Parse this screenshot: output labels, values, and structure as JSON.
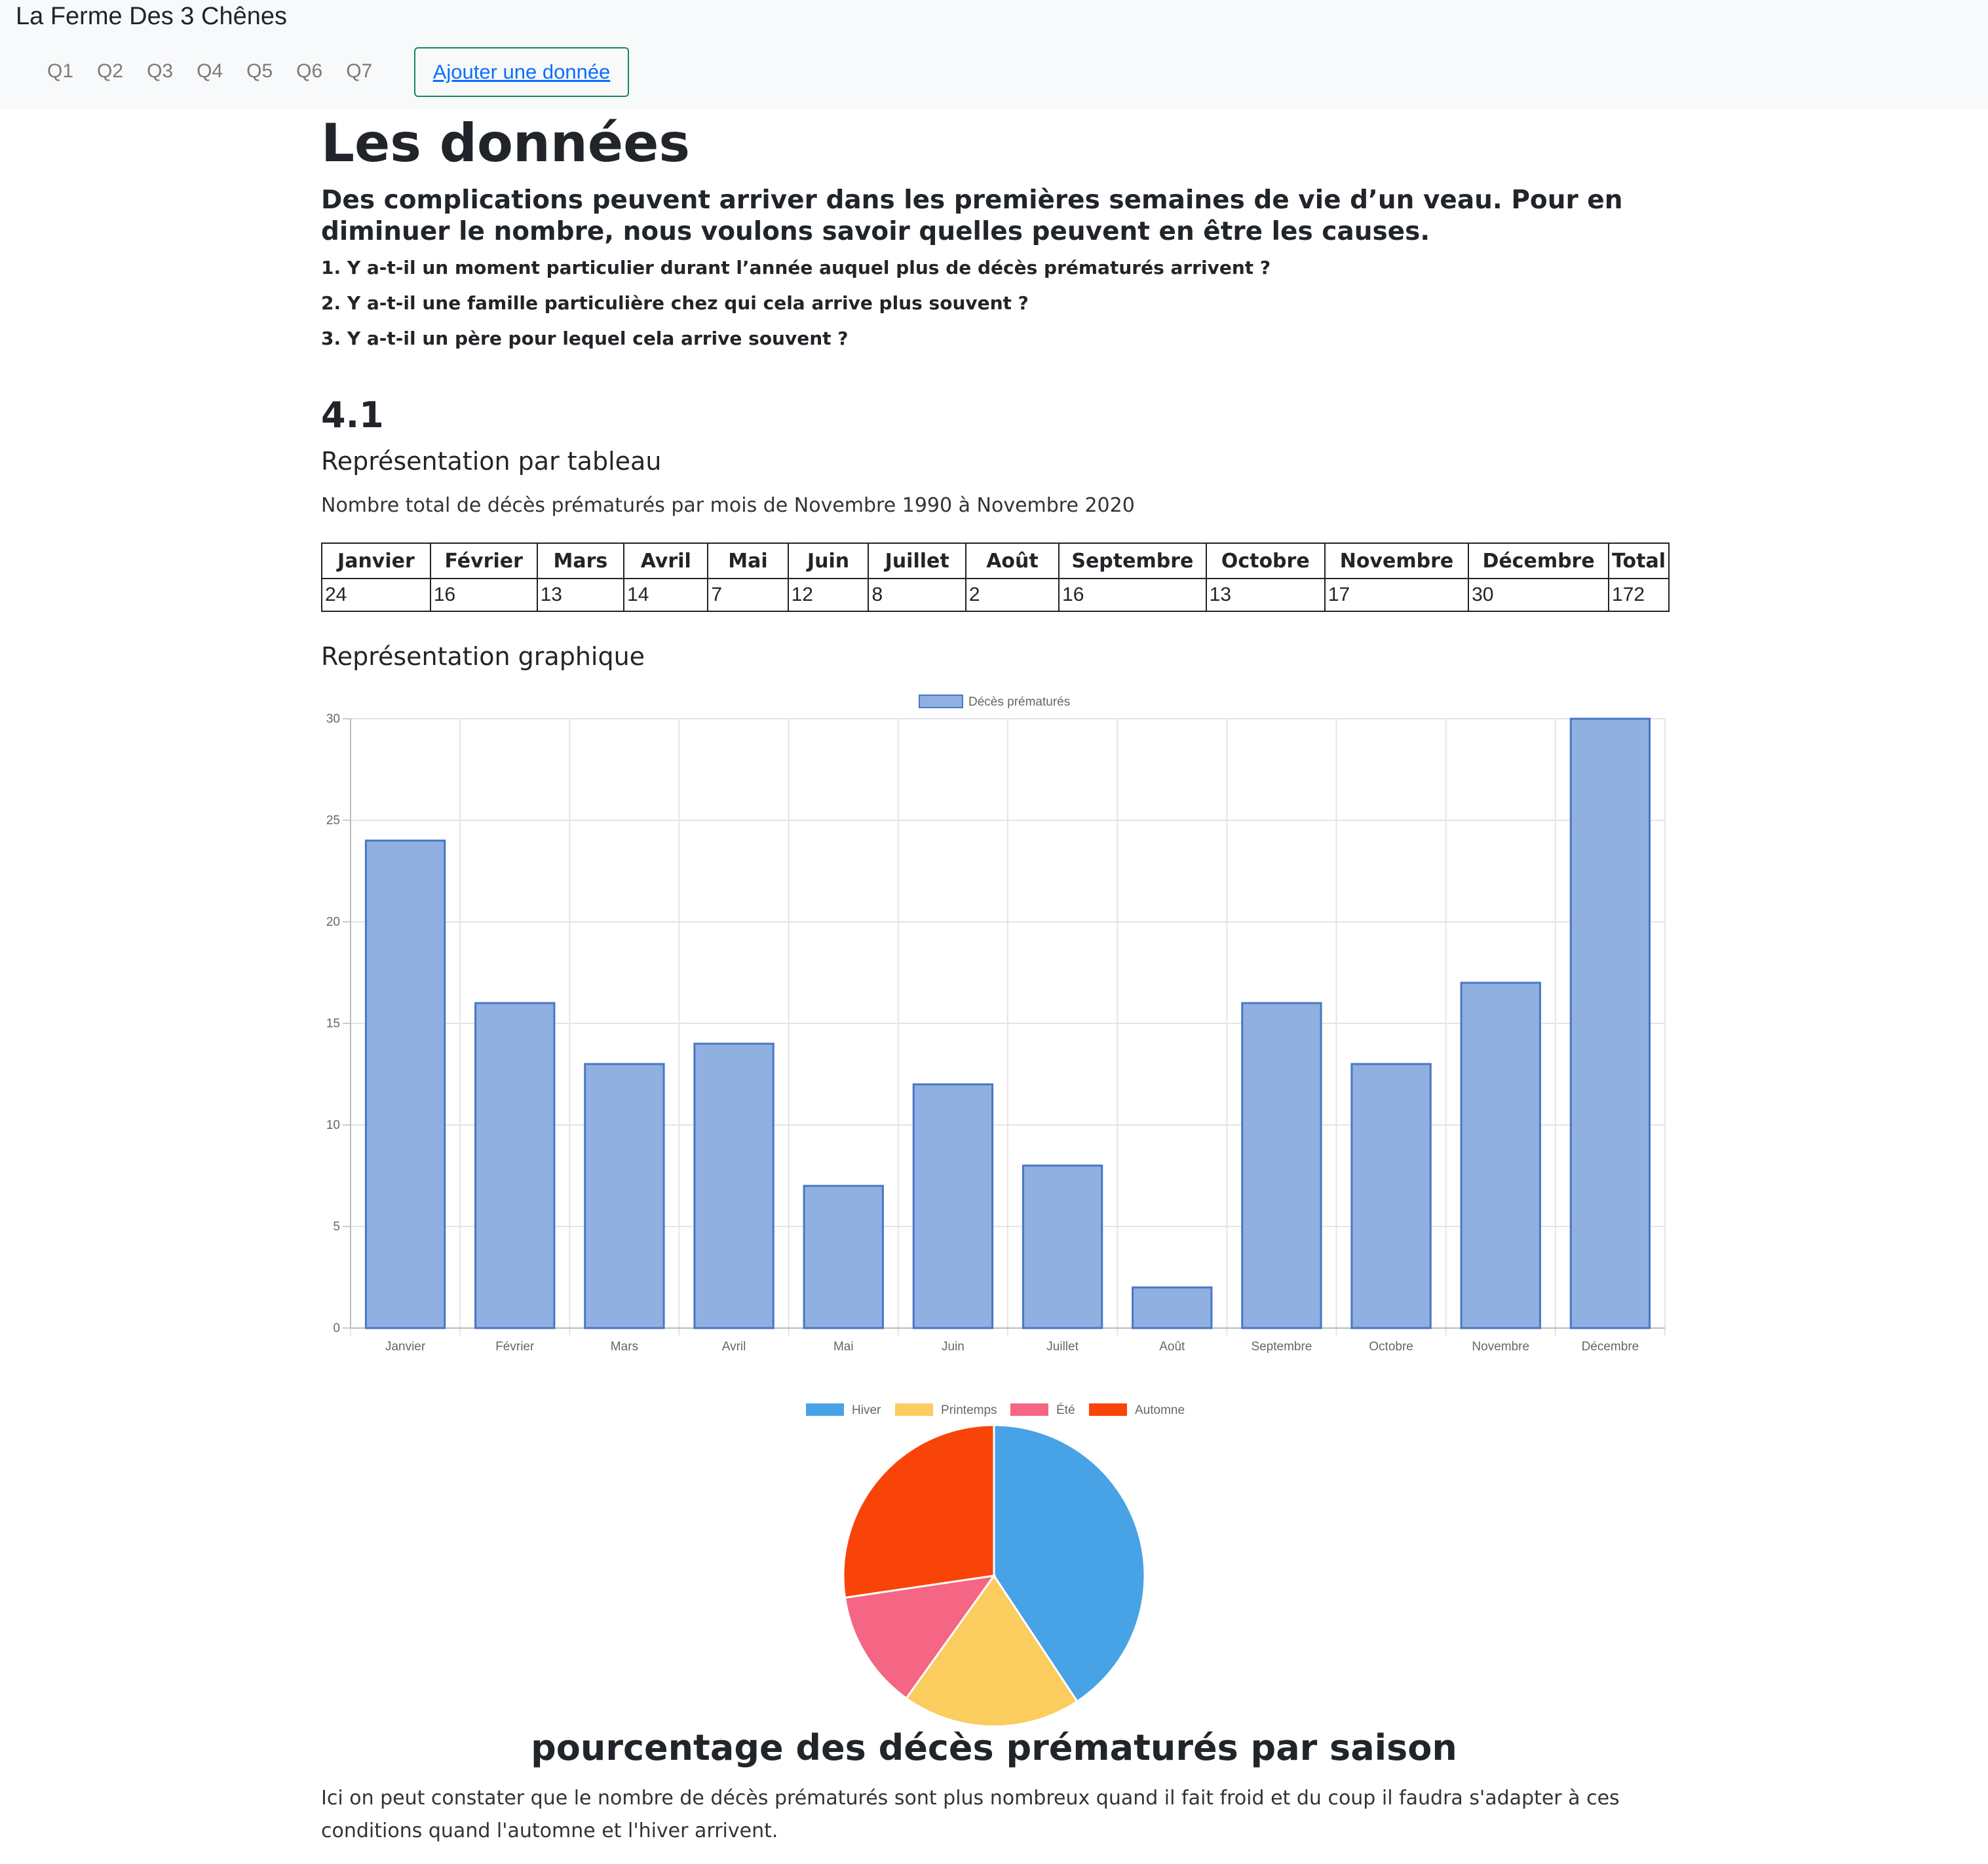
{
  "nav": {
    "brand": "La Ferme Des 3 Chênes",
    "links": [
      "Q1",
      "Q2",
      "Q3",
      "Q4",
      "Q5",
      "Q6",
      "Q7"
    ],
    "add_button": "Ajouter une donnée"
  },
  "page": {
    "title": "Les données",
    "lead": "Des complications peuvent arriver dans les premières semaines de vie d’un veau. Pour en diminuer le nombre, nous voulons savoir quelles peuvent en être les causes.",
    "questions": [
      "1. Y a-t-il un moment particulier durant l’année auquel plus de décès prématurés arrivent ?",
      "2. Y a-t-il une famille particulière chez qui cela arrive plus souvent ?",
      "3. Y a-t-il un père pour lequel cela arrive souvent ?"
    ],
    "section_number": "4.1",
    "table_heading": "Représentation par tableau",
    "table_caption": "Nombre total de décès prématurés par mois de Novembre 1990 à Novembre 2020",
    "graph_heading": "Représentation graphique",
    "pie_title": "pourcentage des décès prématurés par saison",
    "conclusion": "Ici on peut constater que le nombre de décès prématurés sont plus nombreux quand il fait froid et du coup il faudra s'adapter à ces conditions quand l'automne et l'hiver arrivent."
  },
  "table": {
    "headers": [
      "Janvier",
      "Février",
      "Mars",
      "Avril",
      "Mai",
      "Juin",
      "Juillet",
      "Août",
      "Septembre",
      "Octobre",
      "Novembre",
      "Décembre",
      "Total"
    ],
    "values": [
      "24",
      "16",
      "13",
      "14",
      "7",
      "12",
      "8",
      "2",
      "16",
      "13",
      "17",
      "30",
      "172"
    ]
  },
  "chart_data": [
    {
      "type": "bar",
      "categories": [
        "Janvier",
        "Février",
        "Mars",
        "Avril",
        "Mai",
        "Juin",
        "Juillet",
        "Août",
        "Septembre",
        "Octobre",
        "Novembre",
        "Décembre"
      ],
      "series": [
        {
          "name": "Décès prématurés",
          "values": [
            24,
            16,
            13,
            14,
            7,
            12,
            8,
            2,
            16,
            13,
            17,
            30
          ]
        }
      ],
      "ylim": [
        0,
        30
      ],
      "yticks": [
        0,
        5,
        10,
        15,
        20,
        25,
        30
      ],
      "grid": true,
      "legend": "top-center",
      "colors": {
        "fill": "#8fb0e1",
        "stroke": "#4a77c4"
      }
    },
    {
      "type": "pie",
      "labels": [
        "Hiver",
        "Printemps",
        "Été",
        "Automne"
      ],
      "values": [
        70,
        33,
        22,
        47
      ],
      "colors": [
        "#47a2e6",
        "#fbcc5e",
        "#f56584",
        "#f84408"
      ],
      "legend": "top-center",
      "title": "pourcentage des décès prématurés par saison"
    }
  ]
}
